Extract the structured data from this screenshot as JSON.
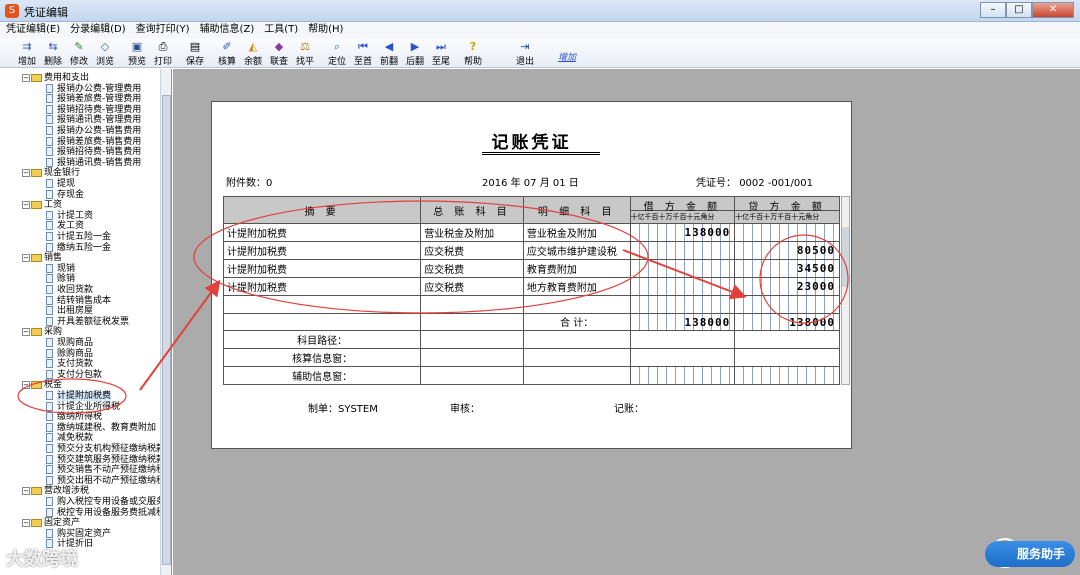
{
  "window": {
    "title": "凭证编辑"
  },
  "menu": [
    "凭证编辑(E)",
    "分录编辑(D)",
    "查询打印(Y)",
    "辅助信息(Z)",
    "工具(T)",
    "帮助(H)"
  ],
  "toolbar": {
    "buttons": [
      {
        "label": "增加",
        "icon": "add-icon"
      },
      {
        "label": "删除",
        "icon": "delete-icon"
      },
      {
        "label": "修改",
        "icon": "edit-icon"
      },
      {
        "label": "浏览",
        "icon": "browse-icon"
      },
      {
        "label": "预览",
        "icon": "preview-icon"
      },
      {
        "label": "打印",
        "icon": "print-icon"
      },
      {
        "label": "保存",
        "icon": "save-icon"
      },
      {
        "label": "核算",
        "icon": "audit-icon"
      },
      {
        "label": "余额",
        "icon": "balance-icon"
      },
      {
        "label": "联查",
        "icon": "query-icon"
      },
      {
        "label": "找平",
        "icon": "scale-icon"
      },
      {
        "label": "定位",
        "icon": "locate-icon"
      },
      {
        "label": "至首",
        "icon": "first-icon"
      },
      {
        "label": "前翻",
        "icon": "prev-icon"
      },
      {
        "label": "后翻",
        "icon": "next-icon"
      },
      {
        "label": "至尾",
        "icon": "last-icon"
      },
      {
        "label": "帮助",
        "icon": "help-icon"
      },
      {
        "label": "退出",
        "icon": "exit-icon"
      }
    ],
    "link": "增加"
  },
  "tree": [
    {
      "label": "费用和支出",
      "type": "folder"
    },
    {
      "label": "报销办公费-管理费用",
      "type": "leaf"
    },
    {
      "label": "报销差旅费-管理费用",
      "type": "leaf"
    },
    {
      "label": "报销招待费-管理费用",
      "type": "leaf"
    },
    {
      "label": "报销通讯费-管理费用",
      "type": "leaf"
    },
    {
      "label": "报销办公费-销售费用",
      "type": "leaf"
    },
    {
      "label": "报销差旅费-销售费用",
      "type": "leaf"
    },
    {
      "label": "报销招待费-销售费用",
      "type": "leaf"
    },
    {
      "label": "报销通讯费-销售费用",
      "type": "leaf"
    },
    {
      "label": "现金银行",
      "type": "folder"
    },
    {
      "label": "提现",
      "type": "leaf"
    },
    {
      "label": "存现金",
      "type": "leaf"
    },
    {
      "label": "工资",
      "type": "folder"
    },
    {
      "label": "计提工资",
      "type": "leaf"
    },
    {
      "label": "发工资",
      "type": "leaf"
    },
    {
      "label": "计提五险一金",
      "type": "leaf"
    },
    {
      "label": "缴纳五险一金",
      "type": "leaf"
    },
    {
      "label": "销售",
      "type": "folder"
    },
    {
      "label": "现销",
      "type": "leaf"
    },
    {
      "label": "赊销",
      "type": "leaf"
    },
    {
      "label": "收回货款",
      "type": "leaf"
    },
    {
      "label": "结转销售成本",
      "type": "leaf"
    },
    {
      "label": "出租房屋",
      "type": "leaf"
    },
    {
      "label": "开具差额征税发票",
      "type": "leaf"
    },
    {
      "label": "采购",
      "type": "folder"
    },
    {
      "label": "现购商品",
      "type": "leaf"
    },
    {
      "label": "赊购商品",
      "type": "leaf"
    },
    {
      "label": "支付货款",
      "type": "leaf"
    },
    {
      "label": "支付分包款",
      "type": "leaf"
    },
    {
      "label": "税金",
      "type": "folder"
    },
    {
      "label": "计提附加税费",
      "type": "leaf",
      "selected": true
    },
    {
      "label": "计提企业所得税",
      "type": "leaf"
    },
    {
      "label": "缴纳所得税",
      "type": "leaf"
    },
    {
      "label": "缴纳城建税、教育费附加",
      "type": "leaf"
    },
    {
      "label": "减免税款",
      "type": "leaf"
    },
    {
      "label": "预交分支机构预征缴纳税款",
      "type": "leaf"
    },
    {
      "label": "预交建筑服务预征缴纳税款",
      "type": "leaf"
    },
    {
      "label": "预交销售不动产预征缴纳税",
      "type": "leaf"
    },
    {
      "label": "预交出租不动产预征缴纳税",
      "type": "leaf"
    },
    {
      "label": "营改增涉税",
      "type": "folder"
    },
    {
      "label": "购入税控专用设备或交服务",
      "type": "leaf"
    },
    {
      "label": "税控专用设备服务费抵减税额",
      "type": "leaf"
    },
    {
      "label": "固定资产",
      "type": "folder"
    },
    {
      "label": "购买固定资产",
      "type": "leaf"
    },
    {
      "label": "计提折旧",
      "type": "leaf"
    }
  ],
  "voucher": {
    "title": "记账凭证",
    "attachments_label": "附件数：",
    "attachments": "0",
    "date": "2016  年 07 月 01 日",
    "number_label": "凭证号：",
    "number": "0002 -001/001",
    "headers": {
      "summary": "摘    要",
      "account": "总 账 科 目",
      "detail": "明 细 科 目",
      "debit": "借 方 金 额",
      "credit": "贷 方 金 额",
      "units": "十亿千百十万千百十元角分"
    },
    "rows": [
      {
        "summary": "计提附加税费",
        "account": "营业税金及附加",
        "detail": "营业税金及附加",
        "debit": "138000",
        "credit": ""
      },
      {
        "summary": "计提附加税费",
        "account": "应交税费",
        "detail": "应交城市维护建设税",
        "debit": "",
        "credit": "80500"
      },
      {
        "summary": "计提附加税费",
        "account": "应交税费",
        "detail": "教育费附加",
        "debit": "",
        "credit": "34500"
      },
      {
        "summary": "计提附加税费",
        "account": "应交税费",
        "detail": "地方教育费附加",
        "debit": "",
        "credit": "23000"
      },
      {
        "summary": "",
        "account": "",
        "detail": "",
        "debit": "",
        "credit": ""
      }
    ],
    "total_label": "合    计：",
    "total_debit": "138000",
    "total_credit": "138000",
    "info_rows": [
      "科目路径：",
      "核算信息窗：",
      "辅助信息窗："
    ],
    "maker_label": "制单：SYSTEM",
    "reviewer_label": "审核：",
    "bookkeeper_label": "记账："
  },
  "assistant": {
    "label": "服务助手"
  },
  "watermark": "大数跨境"
}
